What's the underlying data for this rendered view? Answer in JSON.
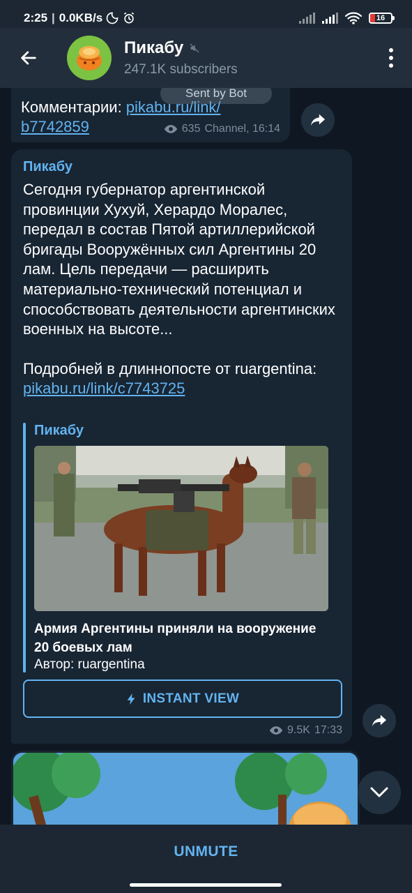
{
  "status_bar": {
    "time": "2:25",
    "network_speed": "0.0KB/s",
    "battery": "16"
  },
  "header": {
    "title": "Пикабу",
    "subscribers": "247.1K subscribers",
    "icons": [
      "back-arrow-icon",
      "mute-icon",
      "more-vert-icon"
    ]
  },
  "messages": [
    {
      "text_prefix": "Комментарии: ",
      "link": "pikabu.ru/link/b7742859",
      "link_line1": "pikabu.ru/link/",
      "link_line2": "b7742859",
      "overlay_pill": "Sent by Bot",
      "views": "635",
      "signature": "Channel, 16:14"
    },
    {
      "author": "Пикабу",
      "paragraph1": "Сегодня губернатор аргентинской провинции Хухуй, Херардо Моралес, передал в состав Пятой артиллерийской бригады Вооружённых сил Аргентины 20 лам. Цель передачи — расширить материально-технический потенциал и способствовать деятельности аргентинских военных на высоте...",
      "paragraph2_prefix": "Подробней в длиннопосте от ruargentina: ",
      "paragraph2_link": "pikabu.ru/link/c7743725",
      "preview": {
        "site": "Пикабу",
        "title": "Армия Аргентины приняли на вооружение 20 боевых лам",
        "description": "Автор: ruargentina"
      },
      "button": "INSTANT VIEW",
      "views": "9.5K",
      "time": "17:33"
    }
  ],
  "bottom_bar": {
    "unmute_label": "UNMUTE"
  },
  "colors": {
    "accent": "#62b3ef",
    "bubble": "#182533",
    "background": "#0f1822",
    "header": "#222e3b"
  }
}
